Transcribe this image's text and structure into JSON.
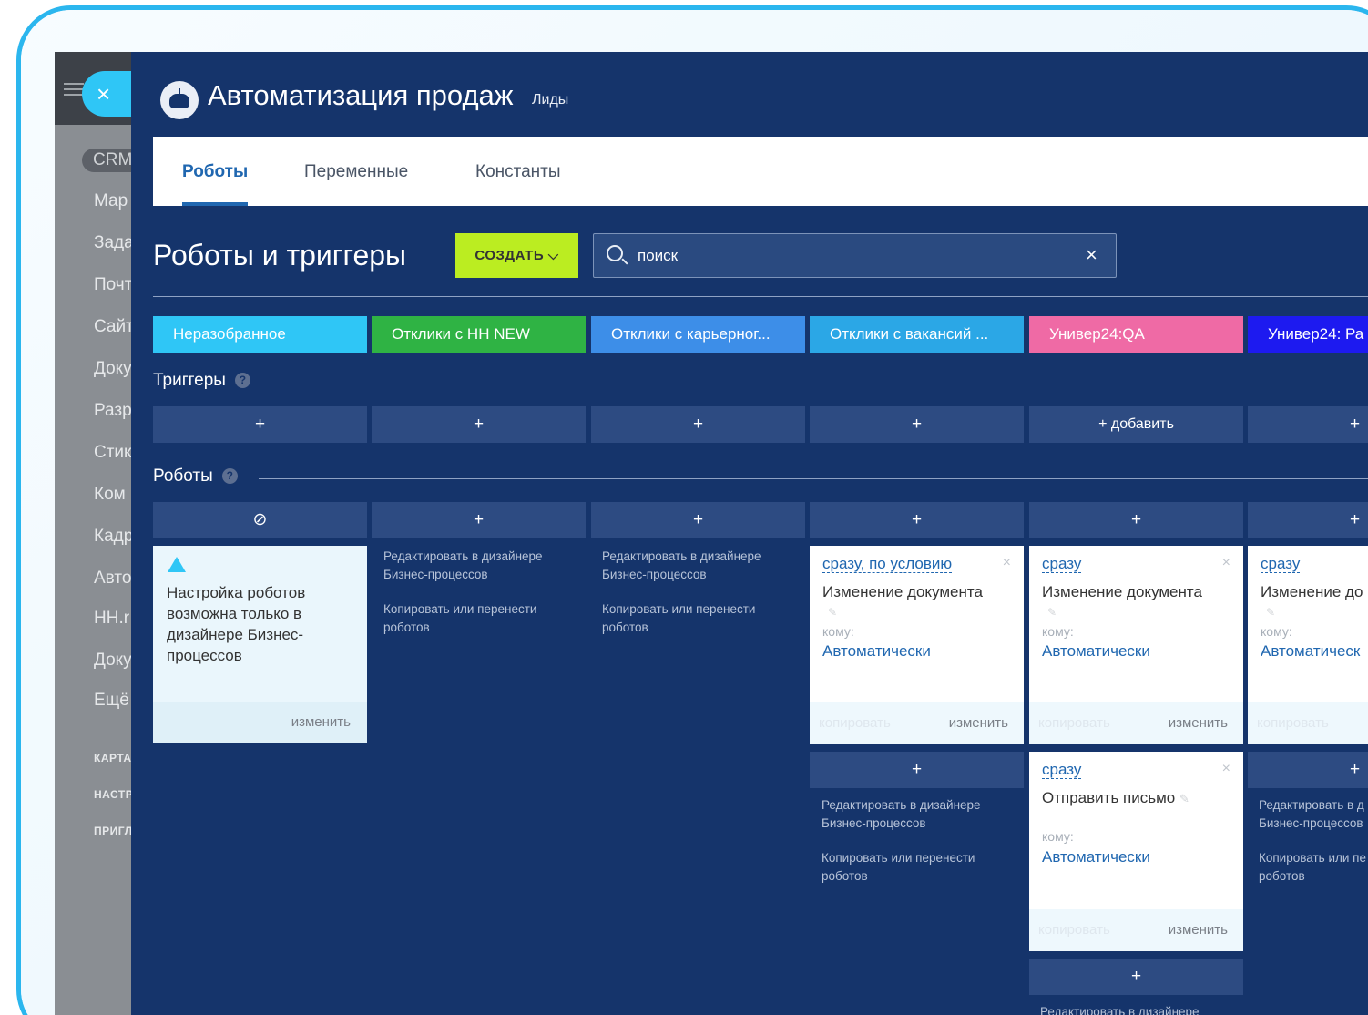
{
  "sidebar": {
    "pill": "CRM",
    "items": [
      "Мар",
      "Зада",
      "Почт",
      "Сайт",
      "Доку",
      "Разр",
      "Стик",
      "Ком",
      "Кадр",
      "Авто",
      "HH.r",
      "Доку",
      "Ещё"
    ],
    "caps_items": [
      "КАРТА",
      "НАСТР",
      "ПРИГЛ"
    ],
    "logo": "R"
  },
  "header": {
    "close_glyph": "×",
    "title": "Автоматизация продаж",
    "subtitle": "Лиды"
  },
  "tabs": [
    {
      "label": "Роботы",
      "active": true
    },
    {
      "label": "Переменные",
      "active": false
    },
    {
      "label": "Константы",
      "active": false
    }
  ],
  "toolbar": {
    "heading": "Роботы и триггеры",
    "create_label": "СОЗДАТЬ ⌵",
    "search_placeholder": "поиск",
    "search_clear": "×"
  },
  "stages": [
    {
      "label": "Неразобранное",
      "color": "#2fc6f6"
    },
    {
      "label": "Отклики с HH NEW",
      "color": "#2fb344"
    },
    {
      "label": "Отклики с карьерног...",
      "color": "#3d8ee8"
    },
    {
      "label": "Отклики с вакансий ...",
      "color": "#2ba7e6"
    },
    {
      "label": "Универ24:QA",
      "color": "#ef6aa5"
    },
    {
      "label": "Универ24: Ра",
      "color": "#1d1af0"
    }
  ],
  "triggers": {
    "label": "Триггеры",
    "help": "?",
    "slots": [
      "+",
      "+",
      "+",
      "+",
      "+ добавить",
      "+"
    ]
  },
  "robots": {
    "label": "Роботы",
    "help": "?",
    "slots": [
      "⊘",
      "+",
      "+",
      "+",
      "+",
      "+"
    ]
  },
  "warning_card": {
    "text": "Настройка роботов возможна только в дизайнере Бизнес-процессов",
    "edit": "изменить"
  },
  "links": {
    "edit_designer": "Редактировать в дизайнере Бизнес-процессов",
    "copy_move": "Копировать или перенести роботов",
    "partial_edit": "Редактировать в д Бизнес-процессов",
    "partial_copy": "Копировать или пе роботов",
    "bottom_edit": "Редактировать в дизайнере"
  },
  "cards": [
    {
      "when": "сразу, по условию",
      "title": "Изменение документа",
      "to": "кому:",
      "who": "Автоматически",
      "copy": "копировать",
      "edit": "изменить"
    },
    {
      "when": "сразу",
      "title": "Изменение документа",
      "to": "кому:",
      "who": "Автоматически",
      "copy": "копировать",
      "edit": "изменить"
    },
    {
      "when": "сразу",
      "title": "Изменение до",
      "to": "кому:",
      "who": "Автоматическ",
      "copy": "копировать",
      "edit": ""
    },
    {
      "when": "сразу",
      "title": "Отправить письмо",
      "to": "кому:",
      "who": "Автоматически",
      "copy": "копировать",
      "edit": "изменить"
    }
  ],
  "slots_extra": [
    "+",
    "+",
    "+"
  ]
}
